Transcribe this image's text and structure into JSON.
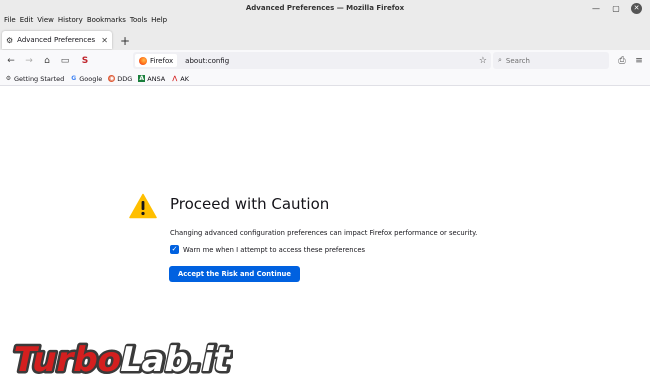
{
  "window": {
    "title": "Advanced Preferences — Mozilla Firefox",
    "menu": [
      "File",
      "Edit",
      "View",
      "History",
      "Bookmarks",
      "Tools",
      "Help"
    ]
  },
  "tab": {
    "label": "Advanced Preferences",
    "new_tab": "+"
  },
  "toolbar": {
    "identity_label": "Firefox",
    "url": "about:config",
    "search_placeholder": "Search"
  },
  "bookmarks": [
    {
      "label": "Getting Started",
      "icon": "gear-icon"
    },
    {
      "label": "Google",
      "icon": "google-icon"
    },
    {
      "label": "DDG",
      "icon": "ddg-icon"
    },
    {
      "label": "ANSA",
      "icon": "ansa-icon"
    },
    {
      "label": "AK",
      "icon": "ak-icon"
    }
  ],
  "content": {
    "heading": "Proceed with Caution",
    "description": "Changing advanced configuration preferences can impact Firefox performance or security.",
    "checkbox_label": "Warn me when I attempt to access these preferences",
    "checkbox_checked": true,
    "accept_button": "Accept the Risk and Continue"
  },
  "watermark": {
    "text": "TurboLab.it"
  },
  "colors": {
    "accent": "#0061e0",
    "warning": "#ffbf00",
    "watermark_red": "#d41f1f"
  }
}
